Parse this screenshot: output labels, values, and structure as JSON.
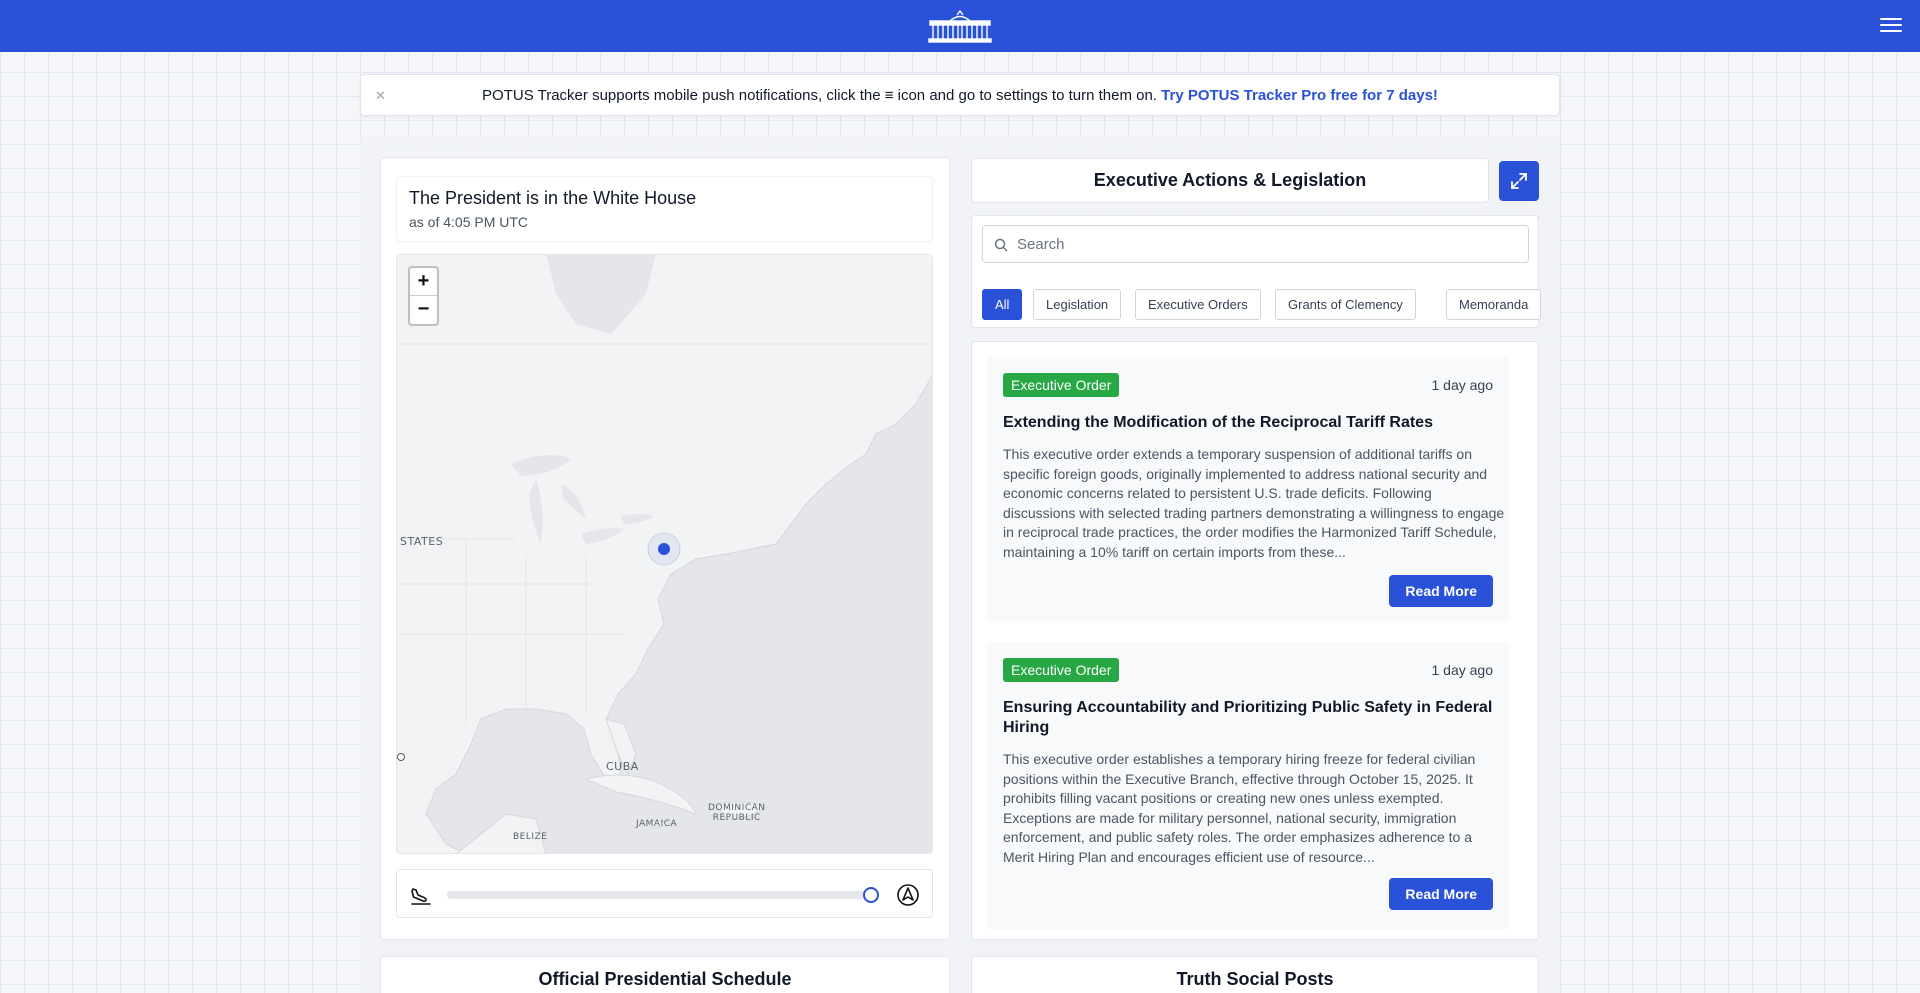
{
  "header": {
    "logo_icon": "white-house-icon",
    "menu_icon": "hamburger-menu-icon"
  },
  "notice": {
    "close_label": "✕",
    "message": "POTUS Tracker supports mobile push notifications, click the ≡ icon and go to settings to turn them on.",
    "promo_link": "Try POTUS Tracker Pro free for 7 days!"
  },
  "location": {
    "title": "The President is in the White House",
    "as_of": "as of 4:05 PM UTC"
  },
  "map": {
    "zoom_in": "+",
    "zoom_out": "−",
    "labels": {
      "states": "STATES",
      "cuba": "CUBA",
      "jamaica": "JAMAICA",
      "dominican_republic_line1": "DOMINICAN",
      "dominican_republic_line2": "REPUBLIC",
      "belize": "BELIZE"
    },
    "colors": {
      "land": "#f2f3f4",
      "water": "#e4e6e9",
      "marker": "#2a52d9"
    }
  },
  "timeline": {
    "left_icon": "airplane-landing-icon",
    "right_icon": "airplane-departure-icon",
    "position": 1.0
  },
  "actions": {
    "title": "Executive Actions & Legislation",
    "expand_icon": "expand-arrows-icon",
    "search_placeholder": "Search",
    "filters": [
      "All",
      "Legislation",
      "Executive Orders",
      "Grants of Clemency",
      "Memoranda"
    ],
    "active_filter": "All",
    "items": [
      {
        "type": "Executive Order",
        "age": "1 day ago",
        "title": "Extending the Modification of the Reciprocal Tariff Rates",
        "body": "This executive order extends a temporary suspension of additional tariffs on specific foreign goods, originally implemented to address national security and economic concerns related to persistent U.S. trade deficits. Following discussions with selected trading partners demonstrating a willingness to engage in reciprocal trade practices, the order modifies the Harmonized Tariff Schedule, maintaining a 10% tariff on certain imports from these...",
        "button": "Read More"
      },
      {
        "type": "Executive Order",
        "age": "1 day ago",
        "title": "Ensuring Accountability and Prioritizing Public Safety in Federal Hiring",
        "body": "This executive order establishes a temporary hiring freeze for federal civilian positions within the Executive Branch, effective through October 15, 2025. It prohibits filling vacant positions or creating new ones unless exempted. Exceptions are made for military personnel, national security, immigration enforcement, and public safety roles. The order emphasizes adherence to a Merit Hiring Plan and encourages efficient use of resource...",
        "button": "Read More"
      }
    ],
    "badge_color": "#28a745"
  },
  "sections": {
    "schedule_title": "Official Presidential Schedule",
    "truth_social_title": "Truth Social Posts"
  },
  "brand_color": "#2a52d9"
}
